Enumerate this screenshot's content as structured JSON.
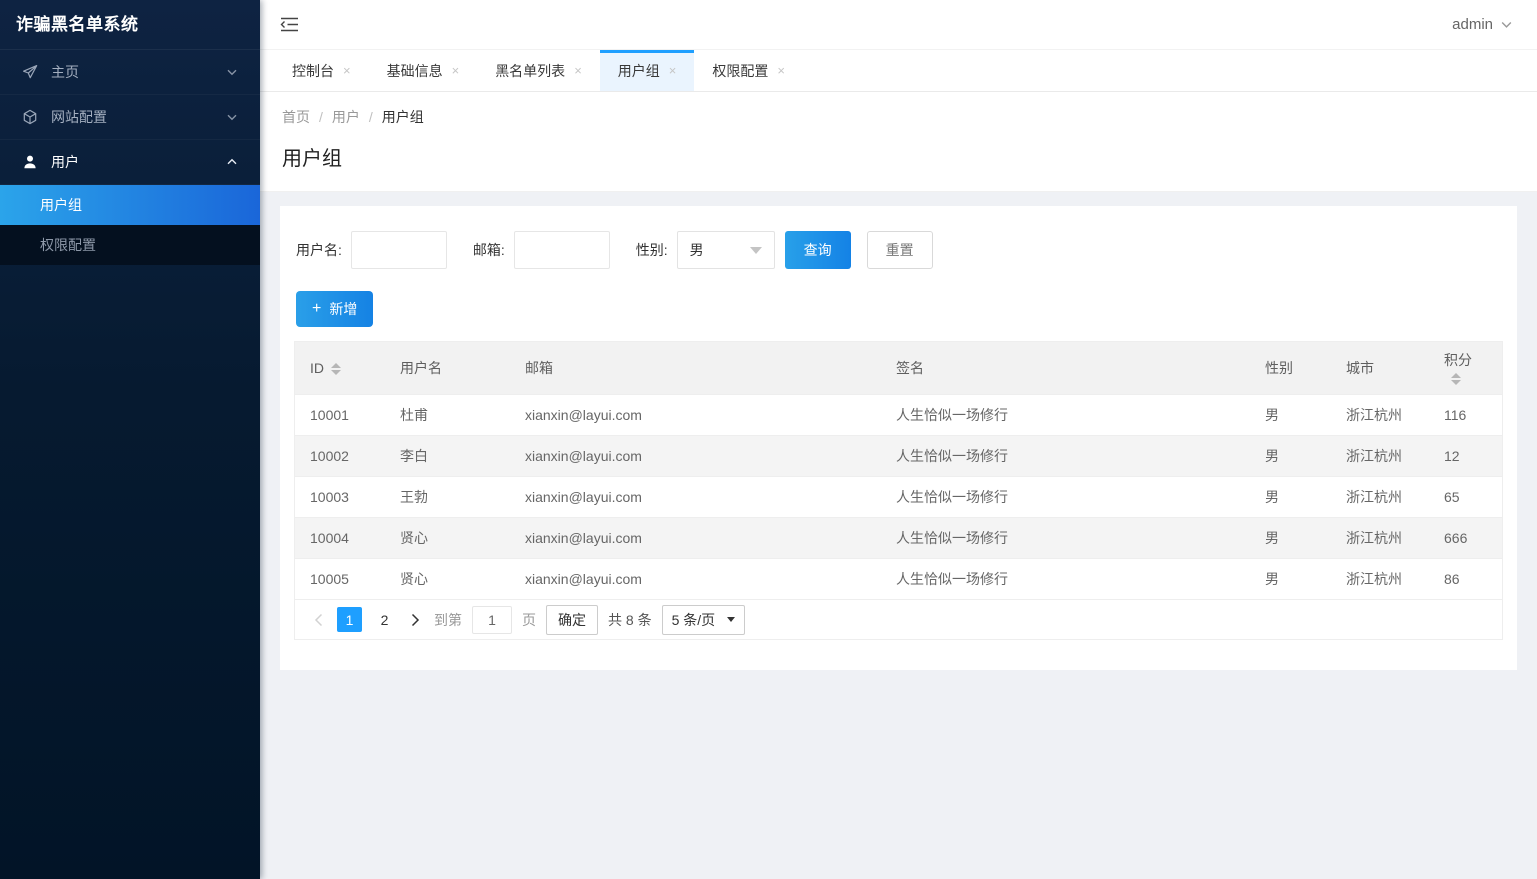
{
  "app": {
    "title": "诈骗黑名单系统",
    "user": "admin"
  },
  "colors": {
    "primary": "#1E9FFF",
    "sidebar_top": "#0e2342",
    "sidebar_mid": "#061a30",
    "sidebar_bottom": "#021427",
    "active_grad_start": "#2ba4ea",
    "active_grad_end": "#1a66d9",
    "content_bg": "#eff1f5",
    "tab_active_bg": "#eaf4fe"
  },
  "icons": {
    "plus": "+",
    "close": "×"
  },
  "sidebar": {
    "items": [
      {
        "label": "主页",
        "icon": "send-icon",
        "state": "collapsed"
      },
      {
        "label": "网站配置",
        "icon": "cube-icon",
        "state": "collapsed"
      },
      {
        "label": "用户",
        "icon": "user-icon",
        "state": "expanded",
        "children": [
          {
            "label": "用户组",
            "active": true
          },
          {
            "label": "权限配置",
            "active": false
          }
        ]
      }
    ]
  },
  "tabs": [
    {
      "label": "控制台",
      "active": false
    },
    {
      "label": "基础信息",
      "active": false
    },
    {
      "label": "黑名单列表",
      "active": false
    },
    {
      "label": "用户组",
      "active": true
    },
    {
      "label": "权限配置",
      "active": false
    }
  ],
  "breadcrumb": {
    "items": [
      "首页",
      "用户",
      "用户组"
    ],
    "sep": "/"
  },
  "page": {
    "title": "用户组"
  },
  "filters": {
    "username_label": "用户名:",
    "email_label": "邮箱:",
    "gender_label": "性别:",
    "gender_value": "男",
    "search_label": "查询",
    "reset_label": "重置",
    "add_label": "新增"
  },
  "table": {
    "columns": [
      "ID",
      "用户名",
      "邮箱",
      "签名",
      "性别",
      "城市",
      "积分"
    ],
    "sortable_columns": [
      "ID",
      "积分"
    ],
    "rows": [
      {
        "id": "10001",
        "username": "杜甫",
        "email": "xianxin@layui.com",
        "sign": "人生恰似一场修行",
        "sex": "男",
        "city": "浙江杭州",
        "score": "116"
      },
      {
        "id": "10002",
        "username": "李白",
        "email": "xianxin@layui.com",
        "sign": "人生恰似一场修行",
        "sex": "男",
        "city": "浙江杭州",
        "score": "12"
      },
      {
        "id": "10003",
        "username": "王勃",
        "email": "xianxin@layui.com",
        "sign": "人生恰似一场修行",
        "sex": "男",
        "city": "浙江杭州",
        "score": "65"
      },
      {
        "id": "10004",
        "username": "贤心",
        "email": "xianxin@layui.com",
        "sign": "人生恰似一场修行",
        "sex": "男",
        "city": "浙江杭州",
        "score": "666"
      },
      {
        "id": "10005",
        "username": "贤心",
        "email": "xianxin@layui.com",
        "sign": "人生恰似一场修行",
        "sex": "男",
        "city": "浙江杭州",
        "score": "86"
      }
    ]
  },
  "pagination": {
    "pages": [
      "1",
      "2"
    ],
    "current": "1",
    "goto_label": "到第",
    "goto_value": "1",
    "page_unit": "页",
    "confirm_label": "确定",
    "total_label": "共 8 条",
    "per_page": "5 条/页"
  }
}
